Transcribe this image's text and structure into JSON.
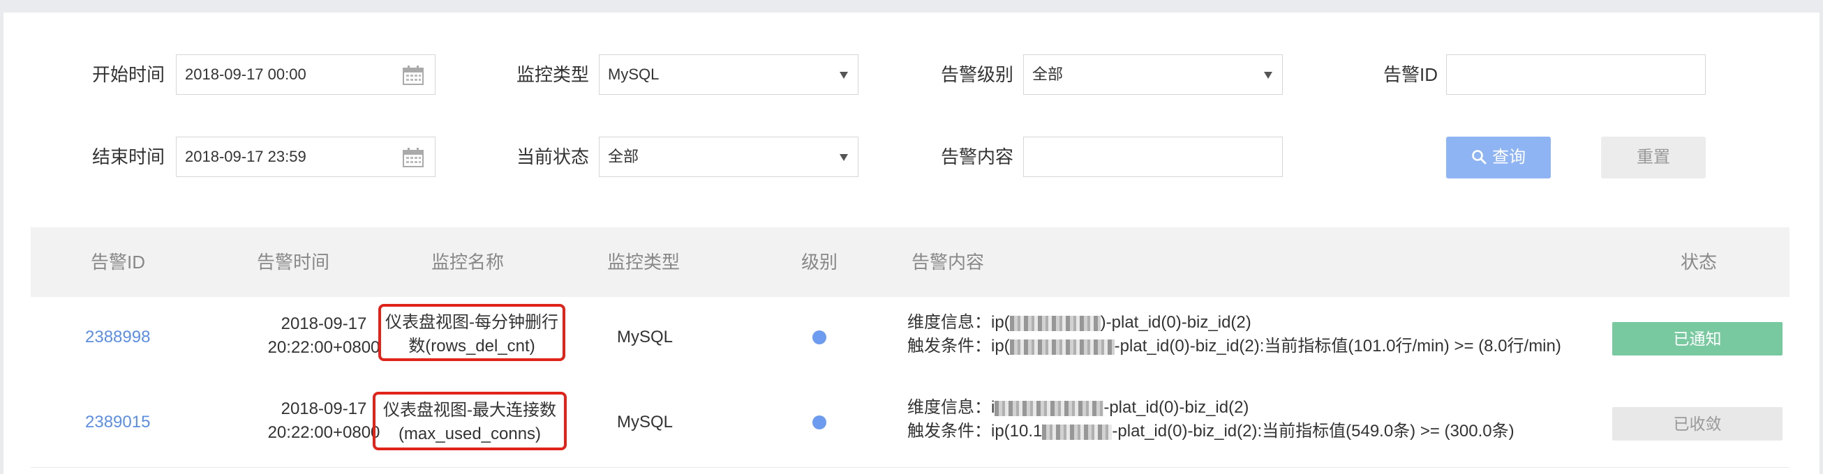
{
  "filters": {
    "start_label": "开始时间",
    "start_value": "2018-09-17 00:00",
    "end_label": "结束时间",
    "end_value": "2018-09-17 23:59",
    "monitor_type_label": "监控类型",
    "monitor_type_value": "MySQL",
    "state_label": "当前状态",
    "state_value": "全部",
    "level_label": "告警级别",
    "level_value": "全部",
    "content_label": "告警内容",
    "content_value": "",
    "alert_id_label": "告警ID",
    "alert_id_value": "",
    "query_label": "查询",
    "reset_label": "重置"
  },
  "table": {
    "headers": {
      "id": "告警ID",
      "time": "告警时间",
      "name": "监控名称",
      "type": "监控类型",
      "level": "级别",
      "content": "告警内容",
      "status": "状态"
    },
    "rows": [
      {
        "id": "2388998",
        "date": "2018-09-17",
        "time": "20:22:00+0800",
        "name1": "仪表盘视图-每分钟删行",
        "name2": "数(rows_del_cnt)",
        "type": "MySQL",
        "dim_prefix": "维度信息：ip(",
        "dim_suffix": ")-plat_id(0)-biz_id(2)",
        "trig_prefix": "触发条件：ip(",
        "trig_suffix": "-plat_id(0)-biz_id(2):当前指标值(101.0行/min) >= (8.0行/min)",
        "status": "已通知"
      },
      {
        "id": "2389015",
        "date": "2018-09-17",
        "time": "20:22:00+0800",
        "name1": "仪表盘视图-最大连接数",
        "name2": "(max_used_conns)",
        "type": "MySQL",
        "dim_prefix": "维度信息：i",
        "dim_suffix": "-plat_id(0)-biz_id(2)",
        "trig_prefix": "触发条件：ip(10.1",
        "trig_suffix": "-plat_id(0)-biz_id(2):当前指标值(549.0条) >= (300.0条)",
        "status": "已收敛"
      }
    ]
  },
  "colors": {
    "link": "#5b8ee6",
    "notified": "#78c9a0",
    "highlight": "#e0241b",
    "query_button": "#8fb4f4"
  }
}
